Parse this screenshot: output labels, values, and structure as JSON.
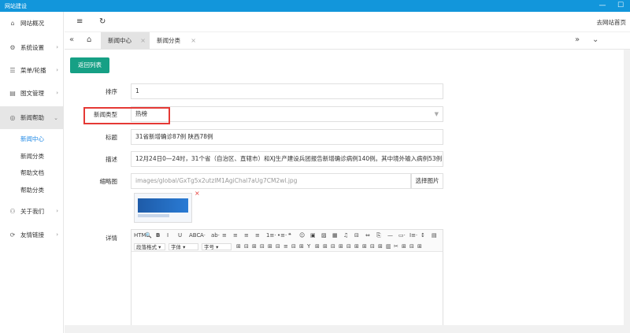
{
  "window": {
    "title": "网站建设",
    "minimize": "—",
    "maximize": "☐"
  },
  "sidebar": {
    "items": [
      {
        "label": "网站概况",
        "icon": "graduation-cap-icon",
        "glyph": "⌂",
        "arrow": ""
      },
      {
        "label": "系统设置",
        "icon": "gear-icon",
        "glyph": "⚙",
        "arrow": "›"
      },
      {
        "label": "菜单/轮播",
        "icon": "list-icon",
        "glyph": "☰",
        "arrow": "›"
      },
      {
        "label": "图文管理",
        "icon": "document-icon",
        "glyph": "▤",
        "arrow": "›"
      },
      {
        "label": "新闻帮助",
        "icon": "globe-icon",
        "glyph": "◎",
        "arrow": "⌄"
      },
      {
        "label": "关于我们",
        "icon": "users-icon",
        "glyph": "⚇",
        "arrow": "›"
      },
      {
        "label": "友情链接",
        "icon": "link-icon",
        "glyph": "⟳",
        "arrow": "›"
      }
    ],
    "sub_items": [
      "新闻中心",
      "新闻分类",
      "帮助文档",
      "帮助分类"
    ]
  },
  "topbar": {
    "menu_icon": "≡",
    "refresh_icon": "↻",
    "home_link": "去网站首页"
  },
  "tabs": {
    "back_icon": "«",
    "home_icon": "⌂",
    "forward_icon": "»",
    "more_icon": "⌄",
    "items": [
      {
        "label": "新闻中心",
        "close": "×"
      },
      {
        "label": "新闻分类",
        "close": "×"
      }
    ]
  },
  "form": {
    "back_button": "返回列表",
    "sort": {
      "label": "排序",
      "value": "1"
    },
    "type": {
      "label": "新闻类型",
      "value": "热榜",
      "arrow": "▼"
    },
    "title": {
      "label": "标题",
      "value": "31省新增确诊87例 陕西78例"
    },
    "desc": {
      "label": "描述",
      "value": "12月24日0—24时，31个省（自治区、直辖市）和XJ生产建设兵团报告新增确诊病例140例。其中境外输入病例53例（上"
    },
    "thumb": {
      "label": "缩略图",
      "value": "images/global/GxTg5x2utzlM1AgiChal7aUg7CM2wl.jpg",
      "pick_button": "选择图片",
      "remove": "×"
    },
    "detail": {
      "label": "详情"
    }
  },
  "editor": {
    "row1": [
      "HTML",
      "🔍",
      "B",
      "I",
      "U",
      "ABC",
      "A·",
      "ab·",
      "≡",
      "≡",
      "≡",
      "≡",
      "1≡·",
      "•≡·",
      "❝",
      "☺",
      "▣",
      "▨",
      "▦",
      "♫",
      "⊟",
      "⇔",
      "⎘",
      "—",
      "▭·",
      "I≡·",
      "↕",
      "▤"
    ],
    "dropdowns": [
      "段落格式",
      "字体",
      "字号"
    ],
    "row2": [
      "⊞",
      "⊟",
      "⊞",
      "⊟",
      "⊞",
      "⊟",
      "≡",
      "⊟",
      "⊞",
      "Y",
      "⊞",
      "⊞",
      "⊟",
      "⊞",
      "⊟",
      "⊞",
      "⊞",
      "⊟",
      "⊞",
      "▥",
      "✂",
      "⊞",
      "⊟",
      "⊞"
    ]
  }
}
